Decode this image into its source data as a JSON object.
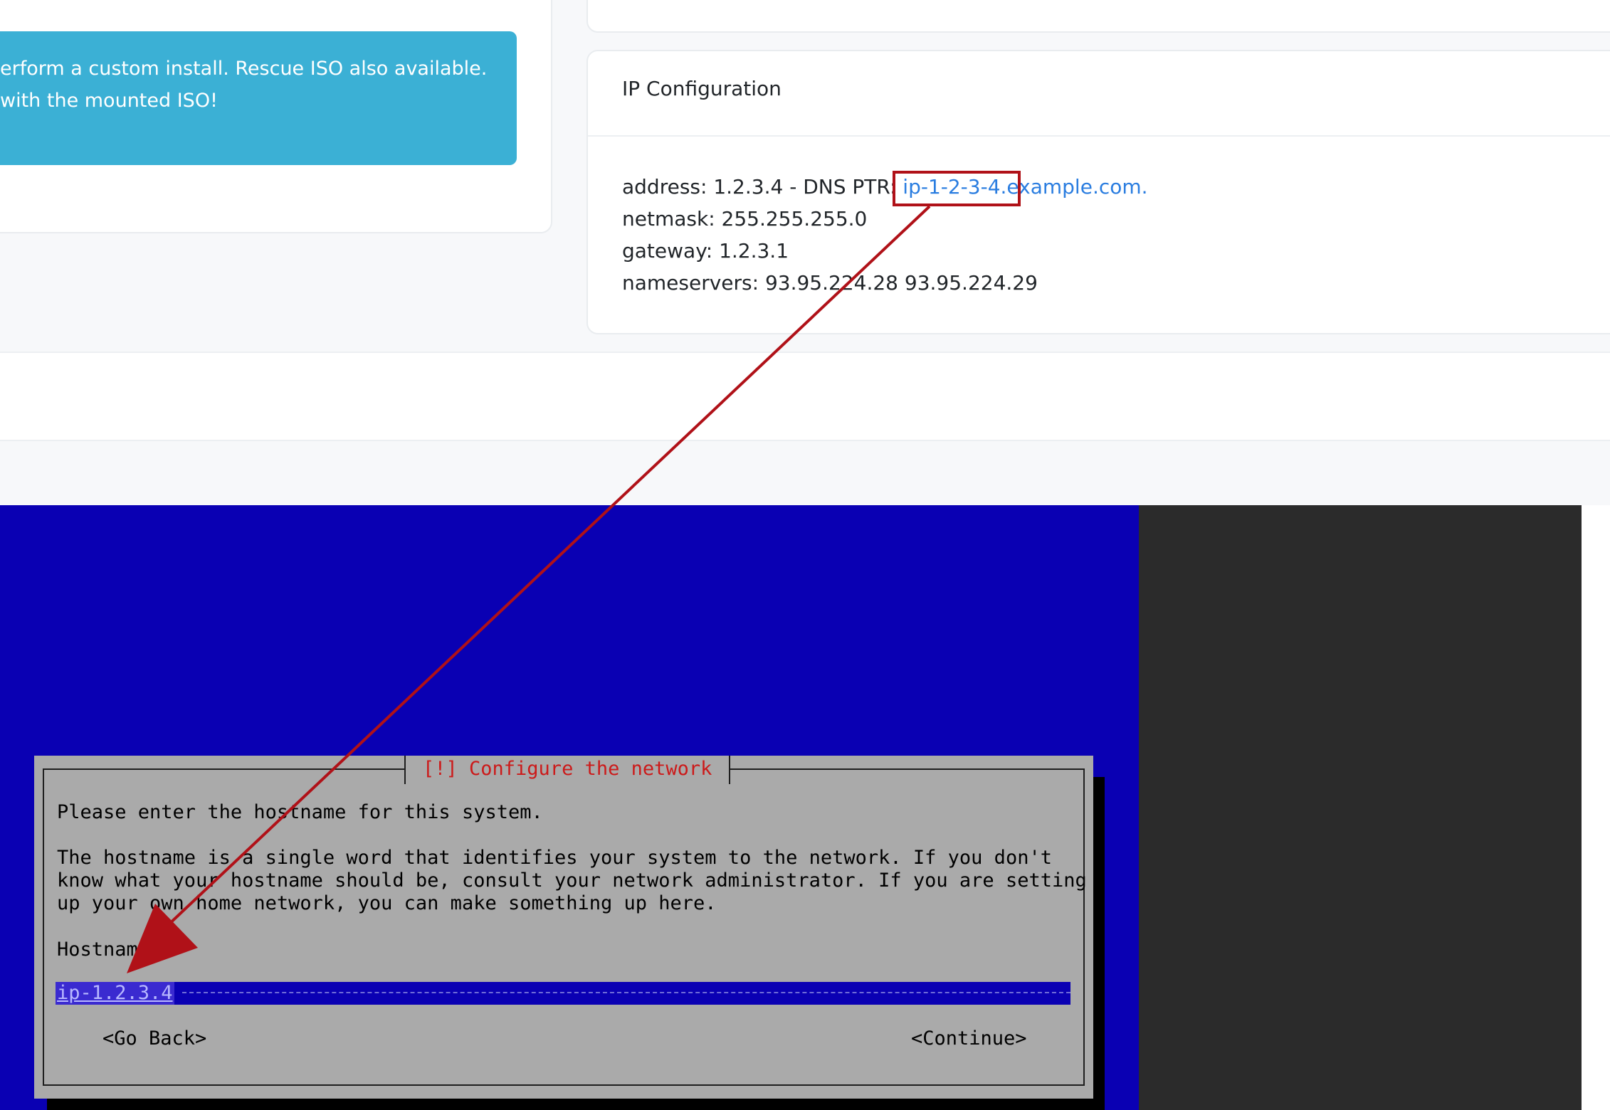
{
  "alert": {
    "line1": "erform a custom install. Rescue ISO also available.",
    "line2": "with the mounted ISO!"
  },
  "ip_card": {
    "title": "IP Configuration",
    "address_label": "address: 1.2.3.4 - DNS PTR: ",
    "ptr_link": "ip-1-2-3-4.example.com.",
    "netmask": "netmask: 255.255.255.0",
    "gateway": "gateway: 1.2.3.1",
    "nameservers": "nameservers: 93.95.224.28 93.95.224.29"
  },
  "installer": {
    "title": "[!] Configure the network",
    "prompt": "Please enter the hostname for this system.",
    "help": "The hostname is a single word that identifies your system to the network. If you don't\nknow what your hostname should be, consult your network administrator. If you are setting\nup your own home network, you can make something up here.",
    "field_label": "Hostname:",
    "hostname_value": "ip-1.2.3.4",
    "go_back": "<Go Back>",
    "continue": "<Continue>"
  },
  "colors": {
    "alert": "#3bb0d5",
    "link": "#2a7de0",
    "annotation_red": "#b01118",
    "console_blue": "#0a00b3",
    "dialog_gray": "#aaaaaa"
  }
}
